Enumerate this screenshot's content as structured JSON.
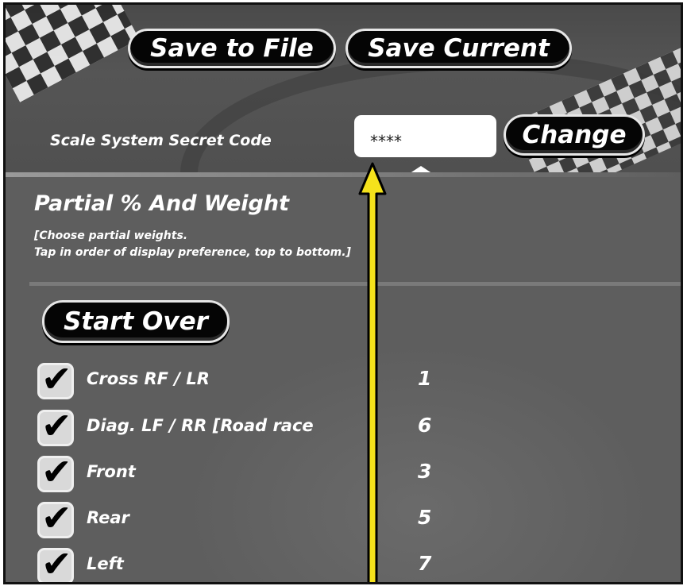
{
  "header": {
    "save_to_file_label": "Save to File",
    "save_current_label": "Save Current"
  },
  "secret_code": {
    "label": "Scale System Secret Code",
    "value": "****",
    "change_label": "Change"
  },
  "partial_section": {
    "title": "Partial % And Weight",
    "description_line1": "[Choose partial weights.",
    "description_line2": "Tap in order of display preference, top to bottom.]",
    "start_over_label": "Start Over",
    "items": [
      {
        "label": "Cross RF / LR",
        "checked": true,
        "order": "1"
      },
      {
        "label": "Diag. LF / RR [Road race",
        "checked": true,
        "order": "6"
      },
      {
        "label": "Front",
        "checked": true,
        "order": "3"
      },
      {
        "label": "Rear",
        "checked": true,
        "order": "5"
      },
      {
        "label": "Left",
        "checked": true,
        "order": "7"
      }
    ]
  },
  "annotation": {
    "arrow_color": "#f5e21b",
    "arrow_outline": "#000000"
  }
}
